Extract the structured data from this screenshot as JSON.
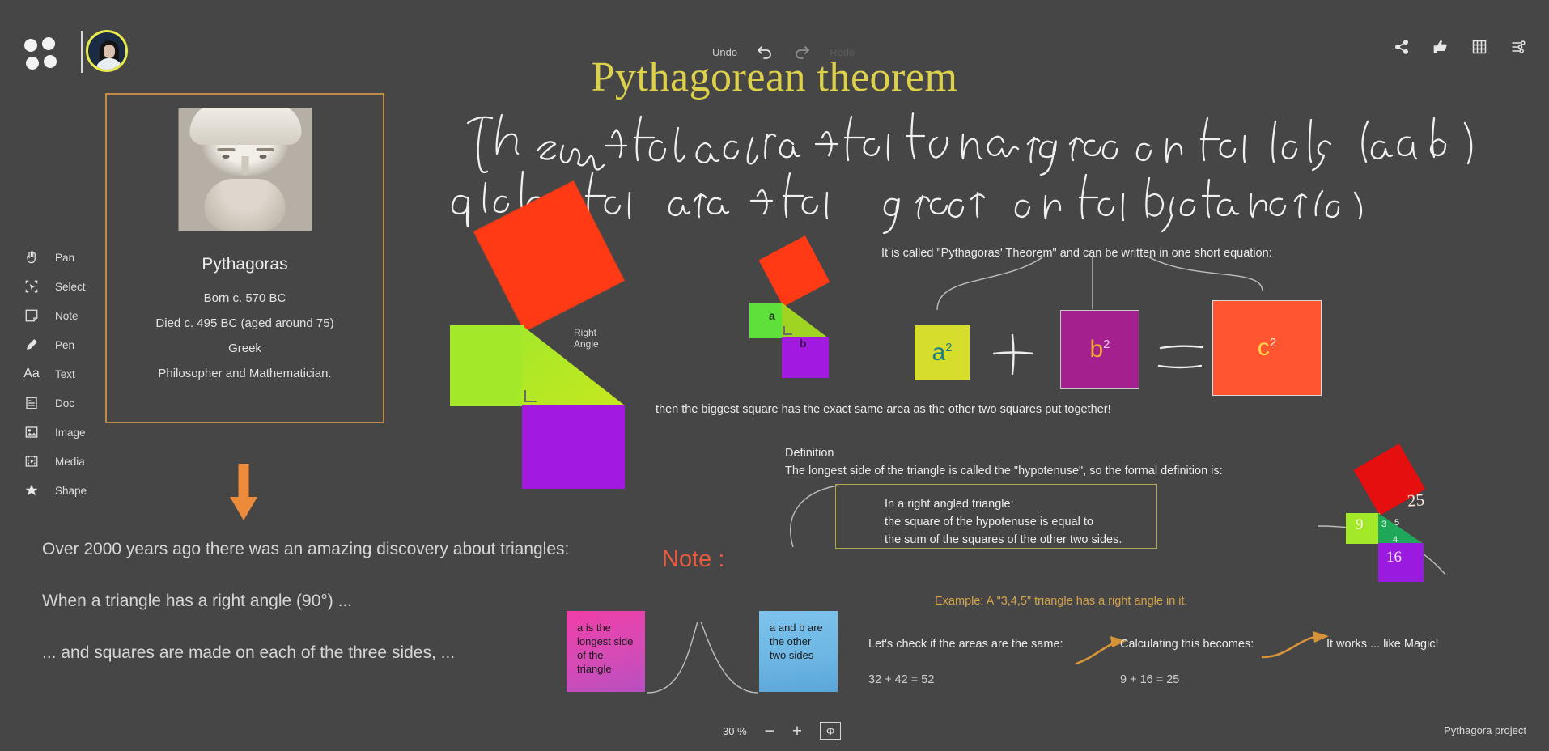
{
  "app": {
    "logo_icon": "four-dot-logo-icon",
    "avatar_label": "user-avatar",
    "project_name": "Pythagora project"
  },
  "toolbar": {
    "undo_label": "Undo",
    "redo_label": "Redo",
    "undo_icon": "undo-arrow-icon",
    "redo_icon": "redo-arrow-icon",
    "right_icons": [
      {
        "name": "share-icon",
        "label": "Share"
      },
      {
        "name": "thumbs-up-icon",
        "label": "Like"
      },
      {
        "name": "grid-icon",
        "label": "Grid"
      },
      {
        "name": "settings-sliders-icon",
        "label": "Settings"
      }
    ]
  },
  "document": {
    "title": "Pythagorean theorem",
    "title_color": "#ddd04a"
  },
  "tools": [
    {
      "label": "Pan",
      "icon": "hand-icon"
    },
    {
      "label": "Select",
      "icon": "select-marquee-icon"
    },
    {
      "label": "Note",
      "icon": "sticky-note-icon"
    },
    {
      "label": "Pen",
      "icon": "pen-icon"
    },
    {
      "label": "Text",
      "icon": "text-aa-icon"
    },
    {
      "label": "Doc",
      "icon": "document-icon"
    },
    {
      "label": "Image",
      "icon": "image-icon"
    },
    {
      "label": "Media",
      "icon": "media-film-icon"
    },
    {
      "label": "Shape",
      "icon": "star-shape-icon"
    }
  ],
  "pythagoras_card": {
    "border_color": "#c08a4a",
    "name": "Pythagoras",
    "lines": [
      "Born c. 570 BC",
      "Died c. 495 BC (aged around 75)",
      "Greek",
      "Philosopher and Mathematician."
    ]
  },
  "handwriting": {
    "line1": "The sum of the areas of the two squares on the legs (a and b)",
    "line2": "equals the area of the square on the hypotenuse (c)"
  },
  "body_text": [
    "Over 2000 years ago there was an amazing discovery about triangles:",
    "When a triangle has a right angle (90°) ...",
    "... and squares are made on each of the three sides, ..."
  ],
  "note_heading": "Note :",
  "sticky_notes": [
    {
      "text": "a is the longest side of the triangle",
      "color": "#ef3ea8",
      "name": "sticky-note-pink"
    },
    {
      "text": "a and b are the other two sides",
      "color": "#7dc3ec",
      "name": "sticky-note-blue"
    }
  ],
  "canvas_text": {
    "called": "It is called \"Pythagoras' Theorem\" and can be written in one short equation:",
    "biggest": "then the biggest square has the exact same area as the other two squares put together!",
    "definition_title": "Definition",
    "definition_sub": "The longest side of the triangle is called the \"hypotenuse\", so the formal definition is:",
    "definition_box": "In a right angled triangle:\nthe square of the hypotenuse is equal to\nthe sum of the squares of the other two sides.",
    "definition_box_border": "#b2a84e",
    "example": "Example: A \"3,4,5\" triangle has a right angle in it.",
    "check": "Let's check if the areas are the same:",
    "calculating": "Calculating this becomes:",
    "works": "It works ... like Magic!",
    "equation1": "32 + 42 = 52",
    "equation2": "9 + 16 = 25",
    "right_angle_label": "Right\nAngle"
  },
  "equation_squares": [
    {
      "label": "a",
      "exp": "2",
      "bg": "#d6dd2c",
      "fg": "#1e7d86",
      "name": "equation-square-a"
    },
    {
      "label": "b",
      "exp": "2",
      "bg": "#a4208f",
      "fg": "#f0a830",
      "name": "equation-square-b"
    },
    {
      "label": "c",
      "exp": "2",
      "bg": "#ff5631",
      "fg": "#f5d84a",
      "name": "equation-square-c"
    }
  ],
  "diagram_mid": {
    "a_label": "a",
    "b_label": "b"
  },
  "diagram_345": {
    "green": "9",
    "purple": "16",
    "red": "25",
    "side_a": "3",
    "side_b": "4",
    "side_c": "5"
  },
  "zoom_control": {
    "value": "30 %",
    "minus": "−",
    "plus": "+",
    "fit_icon": "fit-to-screen-icon",
    "fit_glyph": "Φ"
  }
}
